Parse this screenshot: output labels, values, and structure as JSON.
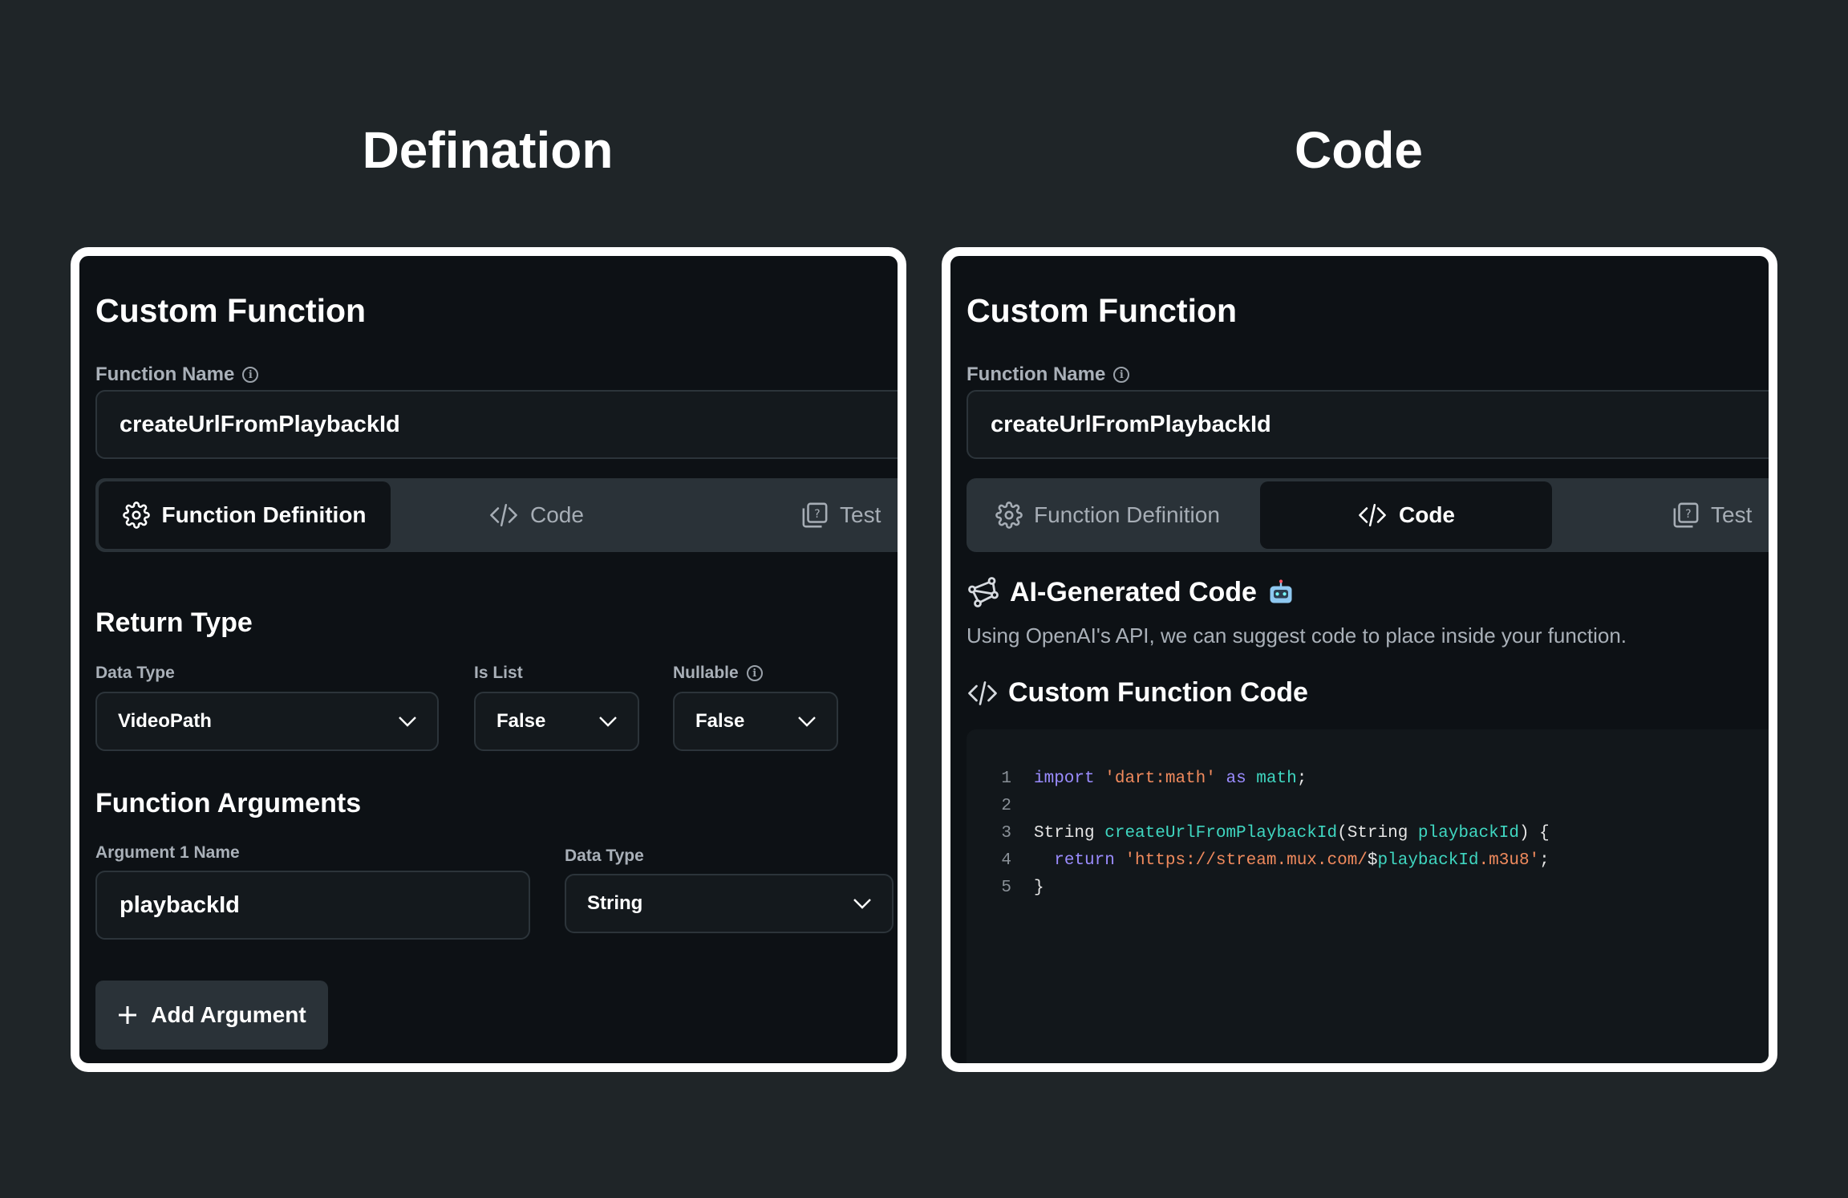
{
  "headings": {
    "left": "Defination",
    "right": "Code"
  },
  "colors": {
    "background": "#1f2528",
    "panel": "#0d1115",
    "tab_bar": "#2a3238",
    "active_tab": "#0f1317",
    "keyword": "#9b8cff",
    "string": "#f08a5d",
    "identifier": "#3fd6c0"
  },
  "left_panel": {
    "title": "Custom Function",
    "function_name_label": "Function Name",
    "function_name_value": "createUrlFromPlaybackId",
    "tabs": [
      {
        "label": "Function Definition",
        "icon": "gear-icon",
        "active": true
      },
      {
        "label": "Code",
        "icon": "code-icon",
        "active": false
      },
      {
        "label": "Test",
        "icon": "test-icon",
        "active": false
      }
    ],
    "return_type": {
      "title": "Return Type",
      "data_type_label": "Data Type",
      "data_type_value": "VideoPath",
      "is_list_label": "Is List",
      "is_list_value": "False",
      "nullable_label": "Nullable",
      "nullable_value": "False"
    },
    "arguments": {
      "title": "Function Arguments",
      "arg1_name_label": "Argument 1 Name",
      "arg1_name_value": "playbackId",
      "arg1_type_label": "Data Type",
      "arg1_type_value": "String"
    },
    "add_argument_label": "Add Argument"
  },
  "right_panel": {
    "title": "Custom Function",
    "function_name_label": "Function Name",
    "function_name_value": "createUrlFromPlaybackId",
    "tabs": [
      {
        "label": "Function Definition",
        "icon": "gear-icon",
        "active": false
      },
      {
        "label": "Code",
        "icon": "code-icon",
        "active": true
      },
      {
        "label": "Test",
        "icon": "test-icon",
        "active": false
      }
    ],
    "ai_title": "AI-Generated Code",
    "ai_description": "Using OpenAI's API, we can suggest code to place inside your function.",
    "code_title": "Custom Function Code",
    "code_lines": [
      {
        "num": "1",
        "tokens": [
          {
            "t": "import",
            "c": "kw"
          },
          {
            "t": " ",
            "c": ""
          },
          {
            "t": "'dart:math'",
            "c": "str"
          },
          {
            "t": " ",
            "c": ""
          },
          {
            "t": "as",
            "c": "kw"
          },
          {
            "t": " ",
            "c": ""
          },
          {
            "t": "math",
            "c": "fn"
          },
          {
            "t": ";",
            "c": ""
          }
        ]
      },
      {
        "num": "2",
        "tokens": []
      },
      {
        "num": "3",
        "tokens": [
          {
            "t": "String",
            "c": "ty"
          },
          {
            "t": " ",
            "c": ""
          },
          {
            "t": "createUrlFromPlaybackId",
            "c": "fn"
          },
          {
            "t": "(String ",
            "c": ""
          },
          {
            "t": "playbackId",
            "c": "fn"
          },
          {
            "t": ") {",
            "c": ""
          }
        ]
      },
      {
        "num": "4",
        "tokens": [
          {
            "t": "  ",
            "c": ""
          },
          {
            "t": "return",
            "c": "kw"
          },
          {
            "t": " ",
            "c": ""
          },
          {
            "t": "'https://stream.mux.com/",
            "c": "str"
          },
          {
            "t": "$",
            "c": ""
          },
          {
            "t": "playbackId",
            "c": "fn"
          },
          {
            "t": ".m3u8'",
            "c": "str"
          },
          {
            "t": ";",
            "c": ""
          }
        ]
      },
      {
        "num": "5",
        "tokens": [
          {
            "t": "}",
            "c": ""
          }
        ]
      }
    ]
  }
}
